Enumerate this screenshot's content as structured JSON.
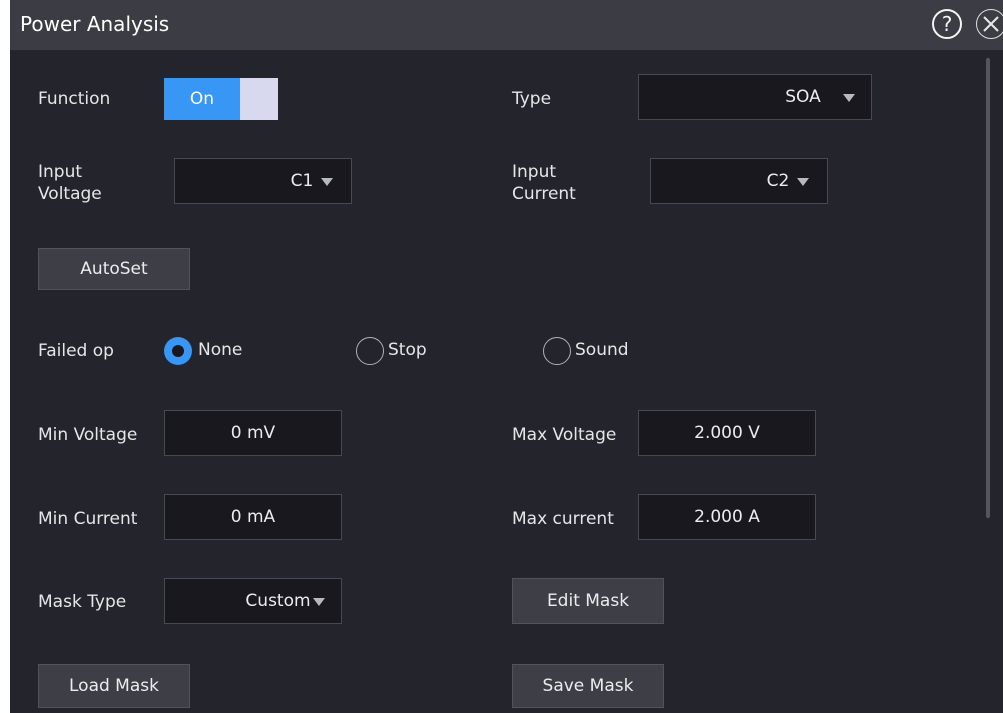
{
  "window": {
    "title": "Power Analysis",
    "help_icon": "question-circle-icon",
    "close_icon": "close-circle-icon",
    "help_glyph": "?"
  },
  "colors": {
    "accent": "#3896f4",
    "panel_bg": "#24242c",
    "title_bg": "#3c3c44"
  },
  "function": {
    "label": "Function",
    "state": "On"
  },
  "type": {
    "label": "Type",
    "value": "SOA"
  },
  "input_voltage": {
    "label_line1": "Input",
    "label_line2": "Voltage",
    "value": "C1"
  },
  "input_current": {
    "label_line1": "Input",
    "label_line2": "Current",
    "value": "C2"
  },
  "autoset": {
    "label": "AutoSet"
  },
  "failed_op": {
    "label": "Failed op",
    "options": [
      "None",
      "Stop",
      "Sound"
    ],
    "selected": "None"
  },
  "min_voltage": {
    "label": "Min Voltage",
    "value": "0 mV"
  },
  "max_voltage": {
    "label": "Max Voltage",
    "value": "2.000 V"
  },
  "min_current": {
    "label": "Min Current",
    "value": "0 mA"
  },
  "max_current": {
    "label": "Max current",
    "value": "2.000 A"
  },
  "mask_type": {
    "label": "Mask Type",
    "value": "Custom"
  },
  "buttons": {
    "edit_mask": "Edit Mask",
    "load_mask": "Load Mask",
    "save_mask": "Save Mask"
  }
}
